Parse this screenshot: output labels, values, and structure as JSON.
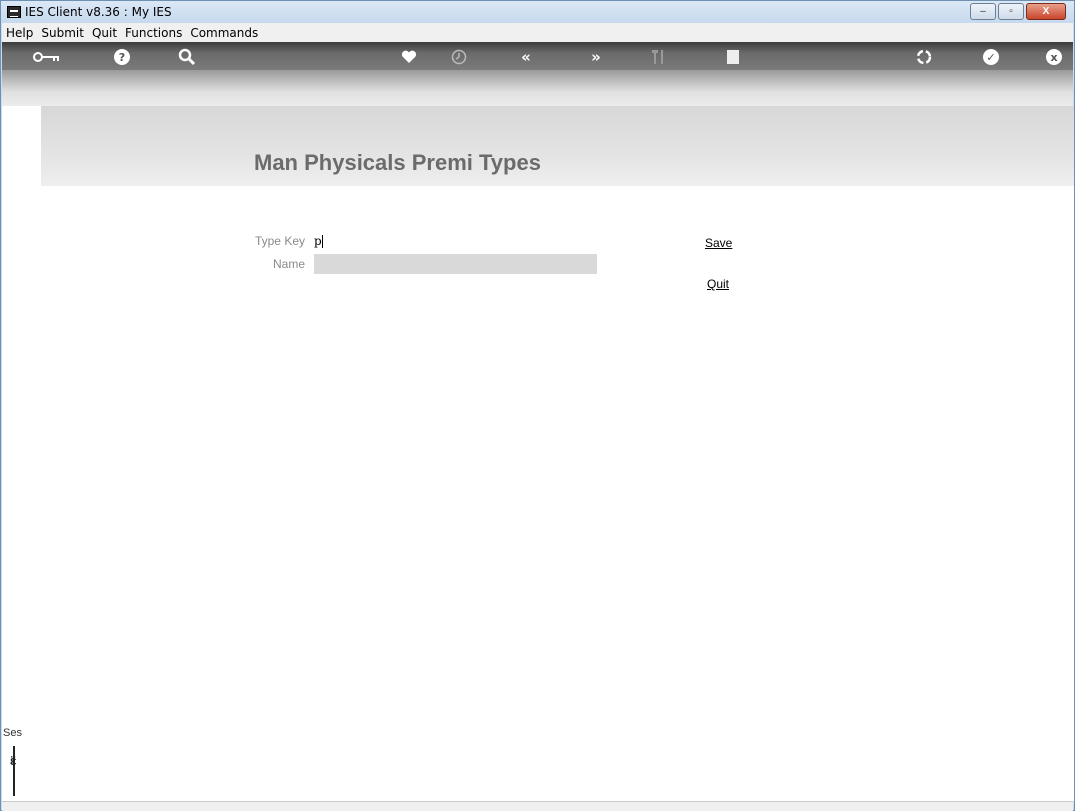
{
  "window": {
    "title": "IES Client v8.36 : My IES",
    "controls": {
      "minimize": "–",
      "maximize": "▫",
      "close": "X"
    }
  },
  "menubar": {
    "items": [
      "Help",
      "Submit",
      "Quit",
      "Functions",
      "Commands"
    ]
  },
  "toolbar": {
    "icons": [
      "key-icon",
      "help-icon",
      "search-icon",
      "heart-icon",
      "clock-icon",
      "rewind-icon",
      "forward-icon",
      "tools-icon",
      "stop-icon",
      "recycle-icon",
      "check-icon",
      "close-icon"
    ]
  },
  "form": {
    "title": "Man Physicals Premi Types",
    "type_key_label": "Type Key",
    "type_key_value": "p",
    "name_label": "Name",
    "name_value": "",
    "save_label": "Save",
    "quit_label": "Quit"
  },
  "sidebar": {
    "session_label": "Ses"
  },
  "colors": {
    "title_text": "#6b6b6b",
    "label_text": "#8a8a8a",
    "input_bg": "#d9d9d9",
    "toolbar_dark": "#4a4a4a"
  }
}
